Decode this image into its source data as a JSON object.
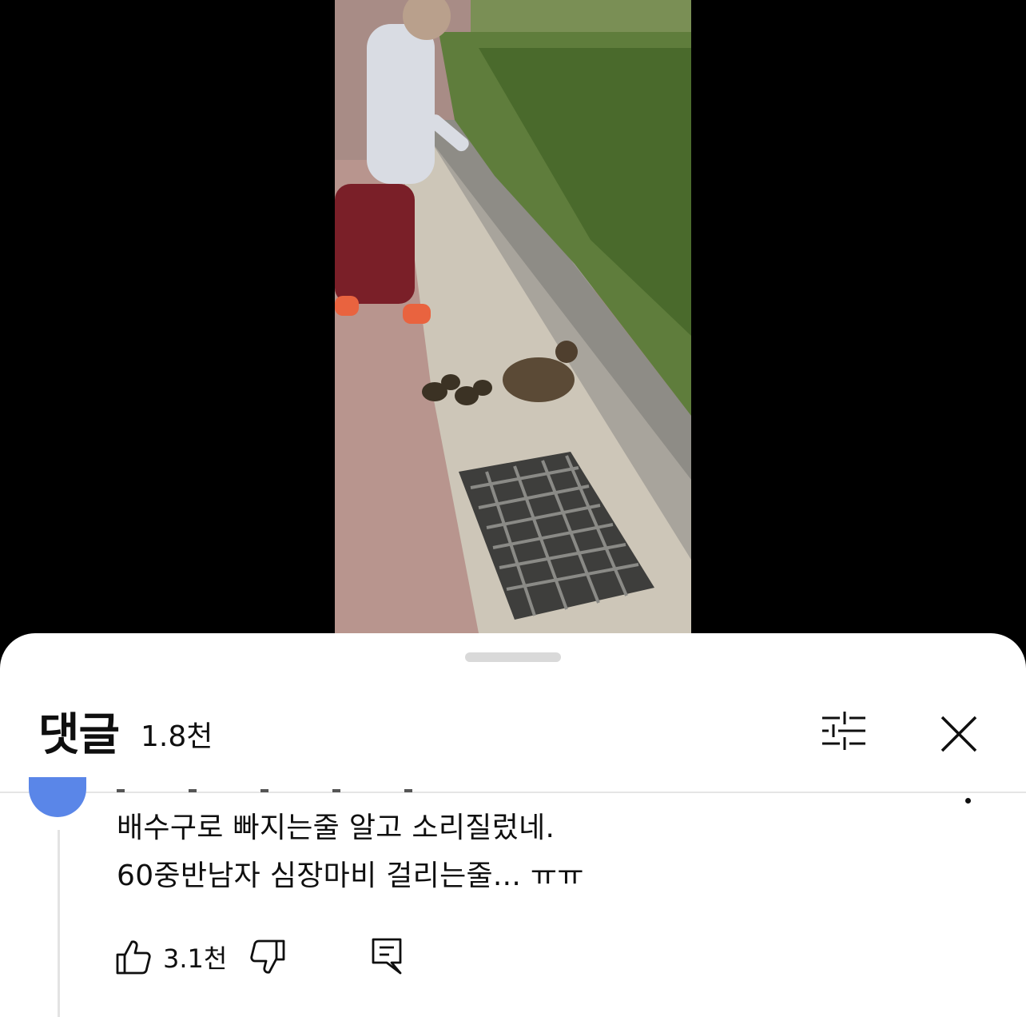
{
  "header": {
    "title": "댓글",
    "count": "1.8천"
  },
  "comment": {
    "lines": [
      "배수구로 빠지는줄 알고 소리질렀네.",
      "60중반남자 심장마비 걸리는줄... ㅠㅠ"
    ],
    "like_count": "3.1천"
  },
  "icons": {
    "filter": "filter-sliders-icon",
    "close": "close-icon",
    "like": "thumbs-up-icon",
    "dislike": "thumbs-down-icon",
    "reply": "reply-icon",
    "menu": "more-vertical-icon"
  },
  "colors": {
    "sheet_bg": "#ffffff",
    "avatar": "#5a86e8",
    "text": "#0f0f0f"
  }
}
